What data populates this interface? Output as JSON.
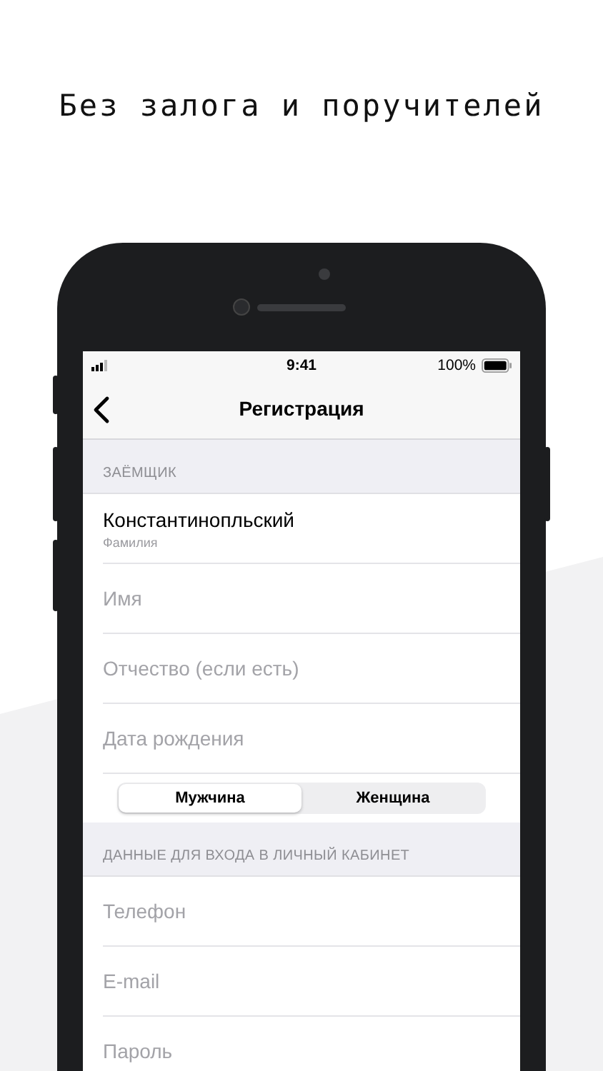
{
  "headline": "Без залога и поручителей",
  "status_bar": {
    "time": "9:41",
    "battery": "100%"
  },
  "nav": {
    "title": "Регистрация"
  },
  "sections": [
    {
      "header": "ЗАЁМЩИК",
      "fields": [
        {
          "value": "Константинопльский",
          "label": "Фамилия"
        },
        {
          "placeholder": "Имя"
        },
        {
          "placeholder": "Отчество (если есть)"
        },
        {
          "placeholder": "Дата рождения"
        }
      ],
      "segments": [
        {
          "label": "Мужчина",
          "selected": true
        },
        {
          "label": "Женщина",
          "selected": false
        }
      ]
    },
    {
      "header": "ДАННЫЕ ДЛЯ ВХОДА В ЛИЧНЫЙ КАБИНЕТ",
      "fields": [
        {
          "placeholder": "Телефон"
        },
        {
          "placeholder": "E-mail"
        },
        {
          "placeholder": "Пароль"
        }
      ]
    }
  ]
}
